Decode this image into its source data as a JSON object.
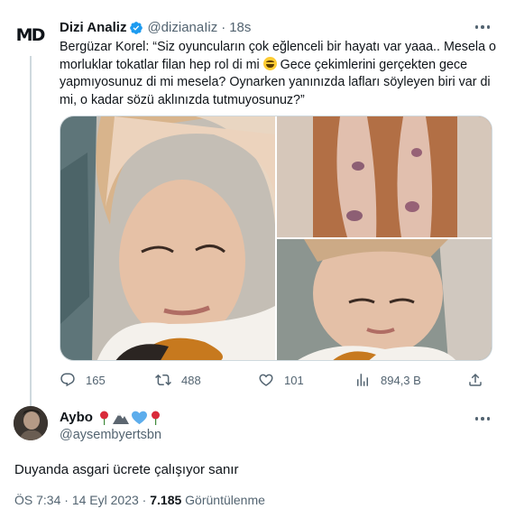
{
  "quoted_tweet": {
    "avatar_text": "MD",
    "display_name": "Dizi Analiz",
    "handle": "@dizianaIiz",
    "separator": "·",
    "time": "18s",
    "text": "Bergüzar Korel: “Siz oyuncuların çok eğlenceli bir hayatı var yaaa.. Mesela o morluklar tokatlar filan hep rol di mi",
    "text_after_emoji": " Gece çekimlerini gerçekten gece yapmıyosunuz di mi mesela? Oynarken yanınızda lafları söyleyen biri var di mi, o kadar sözü aklınızda tutmuyosunuz?”",
    "emoji_icon": "laughing-tears-emoji",
    "stats": {
      "replies": "165",
      "retweets": "488",
      "likes": "101",
      "views": "894,3 B"
    },
    "colors": {
      "verified": "#1d9bf0",
      "muted_text": "#536471"
    }
  },
  "reply": {
    "display_name": "Aybo",
    "emoji_icons": [
      "rose-icon",
      "mountain-icon",
      "blue-heart-icon",
      "rose-icon"
    ],
    "handle": "@aysembyertsbn",
    "text": "Duyanda asgari ücrete çalışıyor sanır",
    "time": "ÖS 7:34",
    "dot": "·",
    "date": "14 Eyl 2023",
    "views_count": "7.185",
    "views_label": "Görüntülenme"
  }
}
